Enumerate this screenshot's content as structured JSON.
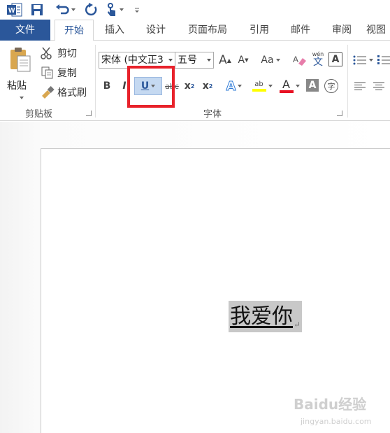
{
  "quick_access": {
    "icons": [
      "word-logo-icon",
      "save-icon",
      "undo-icon",
      "redo-icon",
      "touch-mode-icon",
      "customize-icon"
    ]
  },
  "tabs": {
    "file": "文件",
    "home": "开始",
    "insert": "插入",
    "design": "设计",
    "layout": "页面布局",
    "references": "引用",
    "mailings": "邮件",
    "review": "审阅",
    "view": "视图"
  },
  "clipboard": {
    "paste": "粘贴",
    "cut": "剪切",
    "copy": "复制",
    "format_painter": "格式刷",
    "group_label": "剪贴板"
  },
  "font": {
    "font_name": "宋体 (中文正3",
    "font_size": "五号",
    "grow": "A",
    "shrink": "A",
    "change_case": "Aa",
    "phonetic_top": "wén",
    "phonetic_bottom": "文",
    "char_border": "A",
    "bold": "B",
    "italic": "I",
    "underline": "U",
    "strikethrough": "abc",
    "subscript_base": "x",
    "subscript": "2",
    "superscript_base": "x",
    "superscript": "2",
    "text_effects": "A",
    "highlight": "ab",
    "font_color": "A",
    "char_shading": "A",
    "enclose": "字",
    "group_label": "字体",
    "highlight_color": "#ffff00",
    "font_color_value": "#e81123"
  },
  "document": {
    "text": "我爱你",
    "paragraph_mark": "↵"
  },
  "watermark": {
    "brand": "Baidu经验",
    "url": "jingyan.baidu.com"
  },
  "colors": {
    "accent": "#2b579a",
    "selection_box": "#e8222b",
    "underline_active": "#c5d9f1"
  }
}
